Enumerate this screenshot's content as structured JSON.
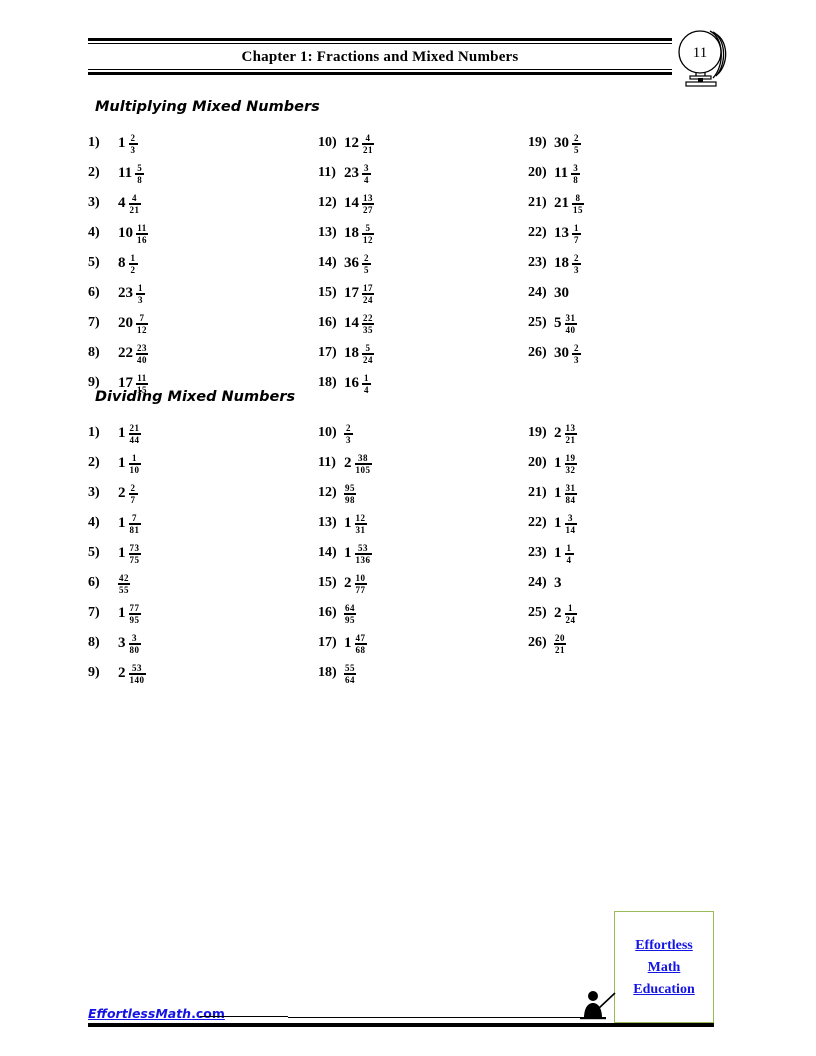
{
  "header": {
    "title": "Chapter 1: Fractions and Mixed Numbers",
    "page_number": "11",
    "emblem_icon": "globe-icon"
  },
  "sections": [
    {
      "id": "multiplying",
      "title": "Multiplying Mixed Numbers",
      "columns": [
        {
          "items": [
            {
              "num": "1)",
              "whole": "1",
              "numer": "2",
              "denom": "3"
            },
            {
              "num": "2)",
              "whole": "11",
              "numer": "5",
              "denom": "8"
            },
            {
              "num": "3)",
              "whole": "4",
              "numer": "4",
              "denom": "21"
            },
            {
              "num": "4)",
              "whole": "10",
              "numer": "11",
              "denom": "16"
            },
            {
              "num": "5)",
              "whole": "8",
              "numer": "1",
              "denom": "2"
            },
            {
              "num": "6)",
              "whole": "23",
              "numer": "1",
              "denom": "3"
            },
            {
              "num": "7)",
              "whole": "20",
              "numer": "7",
              "denom": "12"
            },
            {
              "num": "8)",
              "whole": "22",
              "numer": "23",
              "denom": "40"
            },
            {
              "num": "9)",
              "whole": "17",
              "numer": "11",
              "denom": "15"
            }
          ]
        },
        {
          "items": [
            {
              "num": "10)",
              "whole": "12",
              "numer": "4",
              "denom": "21"
            },
            {
              "num": "11)",
              "whole": "23",
              "numer": "3",
              "denom": "4"
            },
            {
              "num": "12)",
              "whole": "14",
              "numer": "13",
              "denom": "27"
            },
            {
              "num": "13)",
              "whole": "18",
              "numer": "5",
              "denom": "12"
            },
            {
              "num": "14)",
              "whole": "36",
              "numer": "2",
              "denom": "5"
            },
            {
              "num": "15)",
              "whole": "17",
              "numer": "17",
              "denom": "24"
            },
            {
              "num": "16)",
              "whole": "14",
              "numer": "22",
              "denom": "35"
            },
            {
              "num": "17)",
              "whole": "18",
              "numer": "5",
              "denom": "24"
            },
            {
              "num": "18)",
              "whole": "16",
              "numer": "1",
              "denom": "4"
            }
          ]
        },
        {
          "items": [
            {
              "num": "19)",
              "whole": "30",
              "numer": "2",
              "denom": "5"
            },
            {
              "num": "20)",
              "whole": "11",
              "numer": "3",
              "denom": "8"
            },
            {
              "num": "21)",
              "whole": "21",
              "numer": "8",
              "denom": "15"
            },
            {
              "num": "22)",
              "whole": "13",
              "numer": "1",
              "denom": "7"
            },
            {
              "num": "23)",
              "whole": "18",
              "numer": "2",
              "denom": "3"
            },
            {
              "num": "24)",
              "whole": "30",
              "numer": "",
              "denom": ""
            },
            {
              "num": "25)",
              "whole": "5",
              "numer": "31",
              "denom": "40"
            },
            {
              "num": "26)",
              "whole": "30",
              "numer": "2",
              "denom": "3"
            }
          ]
        }
      ]
    },
    {
      "id": "dividing",
      "title": "Dividing Mixed Numbers",
      "columns": [
        {
          "items": [
            {
              "num": "1)",
              "whole": "1",
              "numer": "21",
              "denom": "44"
            },
            {
              "num": "2)",
              "whole": "1",
              "numer": "1",
              "denom": "10"
            },
            {
              "num": "3)",
              "whole": "2",
              "numer": "2",
              "denom": "7"
            },
            {
              "num": "4)",
              "whole": "1",
              "numer": "7",
              "denom": "81"
            },
            {
              "num": "5)",
              "whole": "1",
              "numer": "73",
              "denom": "75"
            },
            {
              "num": "6)",
              "whole": "",
              "numer": "42",
              "denom": "55"
            },
            {
              "num": "7)",
              "whole": "1",
              "numer": "77",
              "denom": "95"
            },
            {
              "num": "8)",
              "whole": "3",
              "numer": "3",
              "denom": "80"
            },
            {
              "num": "9)",
              "whole": "2",
              "numer": "53",
              "denom": "140"
            }
          ]
        },
        {
          "items": [
            {
              "num": "10)",
              "whole": "",
              "numer": "2",
              "denom": "3"
            },
            {
              "num": "11)",
              "whole": "2",
              "numer": "38",
              "denom": "105"
            },
            {
              "num": "12)",
              "whole": "",
              "numer": "95",
              "denom": "98"
            },
            {
              "num": "13)",
              "whole": "1",
              "numer": "12",
              "denom": "31"
            },
            {
              "num": "14)",
              "whole": "1",
              "numer": "53",
              "denom": "136"
            },
            {
              "num": "15)",
              "whole": "2",
              "numer": "10",
              "denom": "77"
            },
            {
              "num": "16)",
              "whole": "",
              "numer": "64",
              "denom": "95"
            },
            {
              "num": "17)",
              "whole": "1",
              "numer": "47",
              "denom": "68"
            },
            {
              "num": "18)",
              "whole": "",
              "numer": "55",
              "denom": "64"
            }
          ]
        },
        {
          "items": [
            {
              "num": "19)",
              "whole": "2",
              "numer": "13",
              "denom": "21"
            },
            {
              "num": "20)",
              "whole": "1",
              "numer": "19",
              "denom": "32"
            },
            {
              "num": "21)",
              "whole": "1",
              "numer": "31",
              "denom": "84"
            },
            {
              "num": "22)",
              "whole": "1",
              "numer": "3",
              "denom": "14"
            },
            {
              "num": "23)",
              "whole": "1",
              "numer": "1",
              "denom": "4"
            },
            {
              "num": "24)",
              "whole": "3",
              "numer": "",
              "denom": ""
            },
            {
              "num": "25)",
              "whole": "2",
              "numer": "1",
              "denom": "24"
            },
            {
              "num": "26)",
              "whole": "",
              "numer": "20",
              "denom": "21"
            }
          ]
        }
      ]
    }
  ],
  "footer": {
    "site_name": "EffortlessMath",
    "site_tld": ".com",
    "logo_lines": [
      "Effortless",
      "Math",
      "Education"
    ],
    "logo_border_color": "#9bbb59",
    "logo_text_color": "#1414e6",
    "teacher_icon": "teacher-pointer-icon"
  }
}
